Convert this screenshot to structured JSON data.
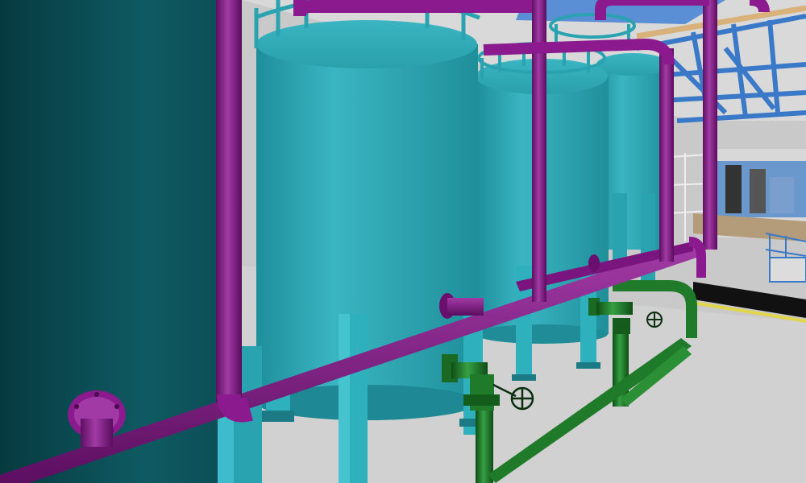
{
  "scene": {
    "description_tags": [
      "storage-tank",
      "purple-pipe",
      "green-pipe",
      "hand-valve",
      "blue-steel-frame"
    ],
    "colors": {
      "background": "#c9c9c9",
      "floor": "#cfcfcf",
      "tank_teal": "#2ea7b4",
      "tank_dark": "#0d4f56",
      "purple_pipe": "#8b1a8e",
      "green_pipe": "#1f7a2a",
      "steel_frame": "#3a78c8",
      "floor_stripe": "#111111"
    }
  }
}
